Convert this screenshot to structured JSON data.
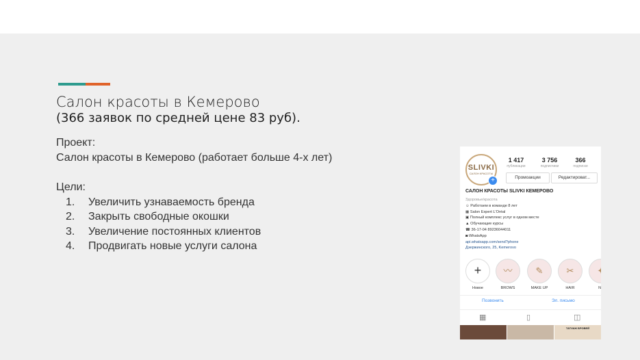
{
  "colors": {
    "accent_teal": "#2e9b8e",
    "accent_orange": "#e0632a"
  },
  "slide": {
    "title": "Салон красоты в Кемерово",
    "subtitle": "(366 заявок по средней цене 83 руб).",
    "project_label": "Проект:",
    "project_text": "Салон красоты в Кемерово (работает больше 4-х лет)",
    "goals_label": "Цели:",
    "goals": [
      {
        "num": "1.",
        "text": "Увеличить узнаваемость бренда"
      },
      {
        "num": "2.",
        "text": "Закрыть свободные окошки"
      },
      {
        "num": "3.",
        "text": "Увеличение постоянных клиентов"
      },
      {
        "num": "4.",
        "text": "Продвигать новые услуги салона"
      }
    ]
  },
  "instagram": {
    "logo_text": "SLIVKI",
    "logo_sub": "САЛОН КРАСОТЫ",
    "stats": [
      {
        "value": "1 417",
        "label": "публикации"
      },
      {
        "value": "3 756",
        "label": "подписчики"
      },
      {
        "value": "366",
        "label": "подписки"
      }
    ],
    "promo_button": "Промоакции",
    "edit_button": "Редактироват...",
    "profile_name": "САЛОН КРАСОТЫ SLIVKI КЕМЕРОВО",
    "bio": {
      "category": "Здоровье/красота",
      "lines": [
        "Работаем в команде 8 лет",
        "Salon Expert L'Oréal",
        "Полный комплекс услуг в одном месте",
        "Обучающие курсы",
        "36-17-04   89236044011",
        "WhatsApp"
      ],
      "link": "api.whatsapp.com/send?phone",
      "address": "Дзержинского, 25, Kemerovo"
    },
    "highlights": [
      {
        "label": "Новое",
        "icon": "+"
      },
      {
        "label": "BROWS",
        "icon": "〰"
      },
      {
        "label": "MAKE UP",
        "icon": "✎"
      },
      {
        "label": "HAIR",
        "icon": "✂"
      },
      {
        "label": "NA",
        "icon": "✦"
      }
    ],
    "call_link": "Позвонить",
    "email_link": "Эл. письмо",
    "grid_caption": "ТАТУАЖ БРОВЕЙ"
  }
}
